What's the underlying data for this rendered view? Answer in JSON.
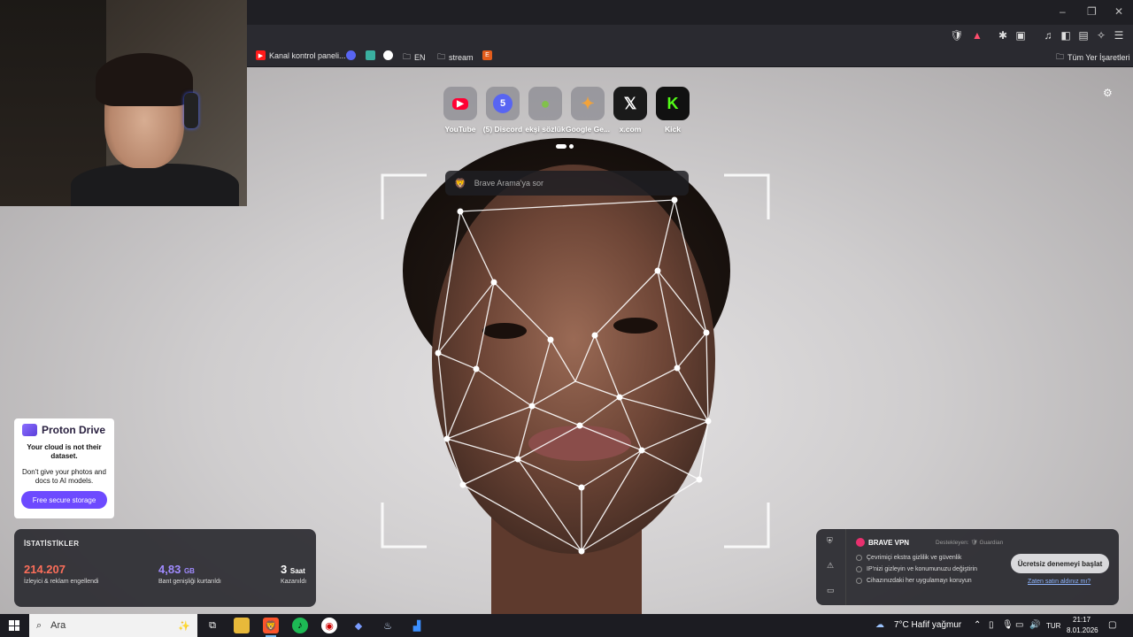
{
  "window": {
    "minimize": "–",
    "restore": "❐",
    "close": "✕"
  },
  "bookmarks": {
    "items": [
      {
        "label": "Kanal kontrol paneli...",
        "color": "#ff1a1a"
      },
      {
        "label": "",
        "color": "#5865f2"
      },
      {
        "label": "",
        "color": "#3ab0a0"
      },
      {
        "label": "",
        "color": "#111111"
      },
      {
        "label": "EN",
        "color": ""
      },
      {
        "label": "stream",
        "color": ""
      },
      {
        "label": "E",
        "color": "#e35d1c"
      }
    ],
    "all_label": "Tüm Yer İşaretleri"
  },
  "speed_dial": [
    {
      "label": "YouTube",
      "glyph": "▶",
      "color": "#ff0033"
    },
    {
      "label": "(5) Discord",
      "glyph": "5",
      "color": "#5865f2"
    },
    {
      "label": "ekşi sözlük",
      "glyph": "●",
      "color": "#81c14b"
    },
    {
      "label": "Google Ge...",
      "glyph": "✦",
      "color": "#4a8cf7"
    },
    {
      "label": "x.com",
      "glyph": "𝕏",
      "color": "#ffffff"
    },
    {
      "label": "Kick",
      "glyph": "K",
      "color": "#53fc18"
    }
  ],
  "search": {
    "placeholder": "Brave Arama'ya sor"
  },
  "proton": {
    "brand": "Proton Drive",
    "headline": "Your cloud is not their dataset.",
    "body": "Don't give your photos and docs to AI models.",
    "cta": "Free secure storage"
  },
  "stats": {
    "heading": "İSTATİSTİKLER",
    "items": [
      {
        "value": "214.207",
        "unit": "",
        "desc": "İzleyici & reklam engellendi",
        "color": "#fb6e5a"
      },
      {
        "value": "4,83",
        "unit": "GB",
        "desc": "Bant genişliği kurtarıldı",
        "color": "#a08bff"
      },
      {
        "value": "3",
        "unit": "Saat",
        "desc": "Kazanıldı",
        "color": "#ffffff"
      }
    ]
  },
  "vpn": {
    "title": "BRAVE VPN",
    "supported_by": "Destekleyen: 🛡 Guardian",
    "features": [
      "Çevrimiçi ekstra gizlilik ve güvenlik",
      "IP'nizi gizleyin ve konumunuzu değiştirin",
      "Cihazınızdaki her uygulamayı koruyun"
    ],
    "cta": "Ücretsiz denemeyi başlat",
    "link": "Zaten satın aldınız mı?"
  },
  "taskbar": {
    "search_placeholder": "Ara",
    "weather": "7°C  Hafif yağmur",
    "lang": "TUR",
    "time": "21:17",
    "date": "8.01.2026"
  }
}
